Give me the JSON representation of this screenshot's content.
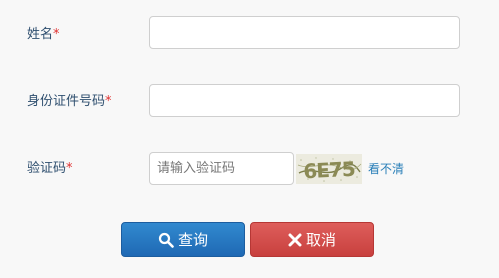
{
  "form": {
    "name": {
      "label": "姓名",
      "required_mark": "*",
      "value": ""
    },
    "id_number": {
      "label": "身份证件号码",
      "required_mark": "*",
      "value": ""
    },
    "captcha": {
      "label": "验证码",
      "required_mark": "*",
      "placeholder": "请输入验证码",
      "value": "",
      "image_text": "6E75",
      "refresh_text": "看不清"
    }
  },
  "buttons": {
    "query_label": "查询",
    "query_icon": "search-icon",
    "cancel_label": "取消",
    "cancel_icon": "close-icon"
  },
  "colors": {
    "label": "#2f4f6f",
    "required": "#e03030",
    "link": "#2a7fb8",
    "query_button": "#2a7bc4",
    "cancel_button": "#d9534f"
  }
}
